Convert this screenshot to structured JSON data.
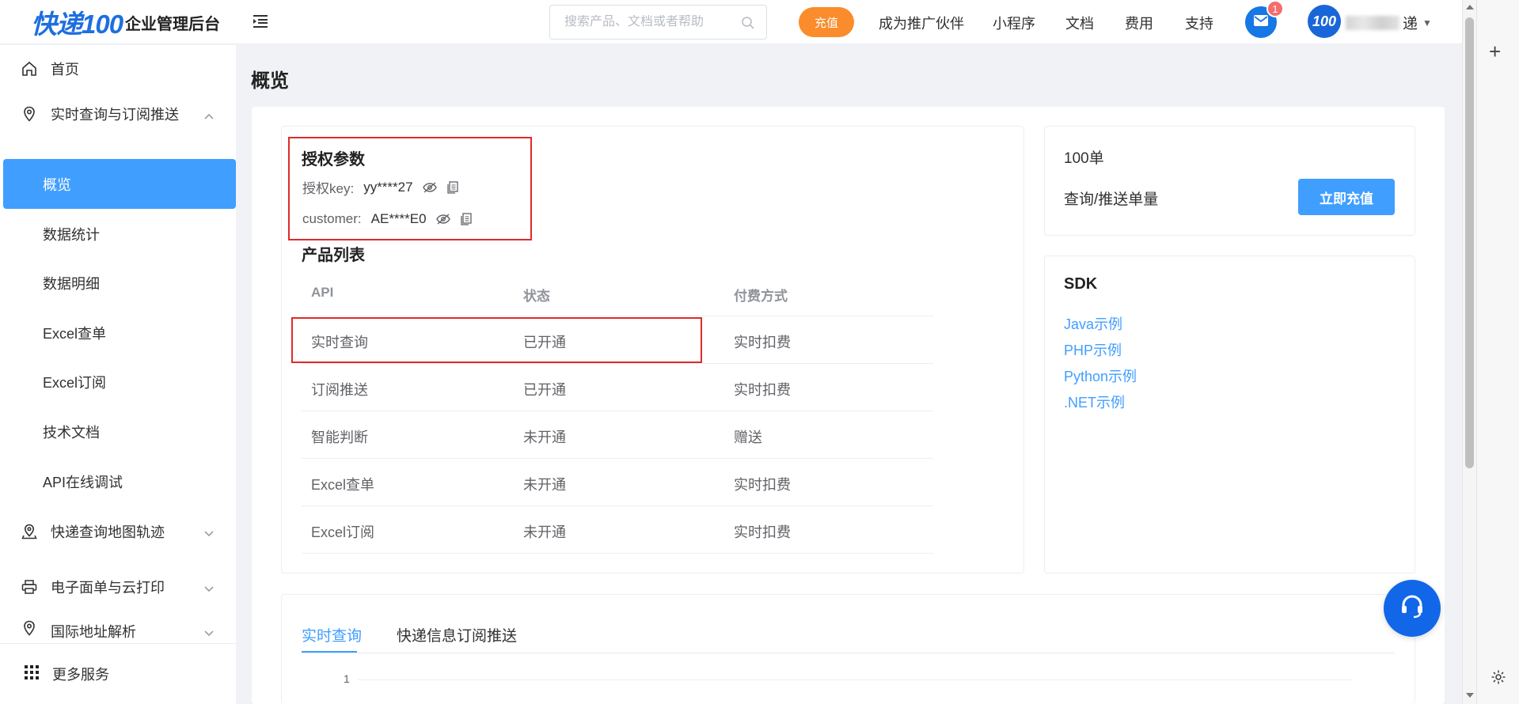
{
  "header": {
    "logo_text": "快递100",
    "app_title": "企业管理后台",
    "search_placeholder": "搜索产品、文档或者帮助",
    "recharge_label": "充值",
    "nav": [
      "成为推广伙伴",
      "小程序",
      "文档",
      "费用",
      "支持"
    ],
    "mail_badge": "1",
    "avatar_text": "100",
    "user_name_suffix": "递"
  },
  "sidebar": {
    "home": "首页",
    "group_realtime": "实时查询与订阅推送",
    "sub_items": [
      "概览",
      "数据统计",
      "数据明细",
      "Excel查单",
      "Excel订阅",
      "技术文档",
      "API在线调试"
    ],
    "active_sub": "概览",
    "group_map": "快递查询地图轨迹",
    "group_print": "电子面单与云打印",
    "group_intl": "国际地址解析",
    "more_services": "更多服务"
  },
  "page": {
    "title": "概览"
  },
  "auth": {
    "title": "授权参数",
    "key_label": "授权key:",
    "key_value": "yy****27",
    "customer_label": "customer:",
    "customer_value": "AE****E0"
  },
  "products": {
    "title": "产品列表",
    "headers": [
      "API",
      "状态",
      "付费方式"
    ],
    "rows": [
      [
        "实时查询",
        "已开通",
        "实时扣费"
      ],
      [
        "订阅推送",
        "已开通",
        "实时扣费"
      ],
      [
        "智能判断",
        "未开通",
        "赠送"
      ],
      [
        "Excel查单",
        "未开通",
        "实时扣费"
      ],
      [
        "Excel订阅",
        "未开通",
        "实时扣费"
      ]
    ]
  },
  "balance": {
    "amount": "100单",
    "label": "查询/推送单量",
    "button": "立即充值"
  },
  "sdk": {
    "title": "SDK",
    "links": [
      "Java示例",
      "PHP示例",
      "Python示例",
      ".NET示例"
    ]
  },
  "tabs": {
    "items": [
      "实时查询",
      "快递信息订阅推送"
    ],
    "active": "实时查询"
  },
  "chart": {
    "y_tick": "1"
  },
  "colors": {
    "primary": "#409eff",
    "orange": "#fa8c2b",
    "highlight_border": "#e02a2a",
    "brand_blue": "#1677e5"
  }
}
